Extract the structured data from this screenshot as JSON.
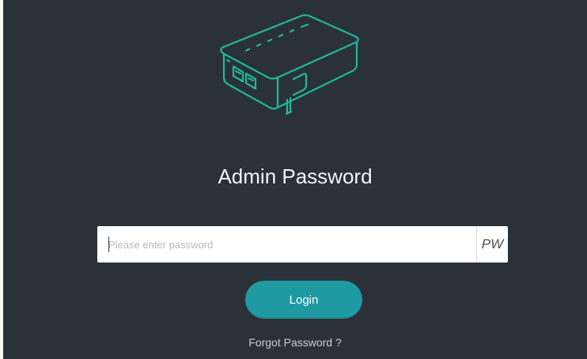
{
  "colors": {
    "background": "#2b3138",
    "accent": "#1f9aa3",
    "device_outline": "#1fb89a"
  },
  "header": {
    "icon": "router-device-icon",
    "title": "Admin Password"
  },
  "password": {
    "placeholder": "Please enter password",
    "value": "",
    "toggle_label": "PW"
  },
  "actions": {
    "login_label": "Login",
    "forgot_label": "Forgot Password ?"
  }
}
